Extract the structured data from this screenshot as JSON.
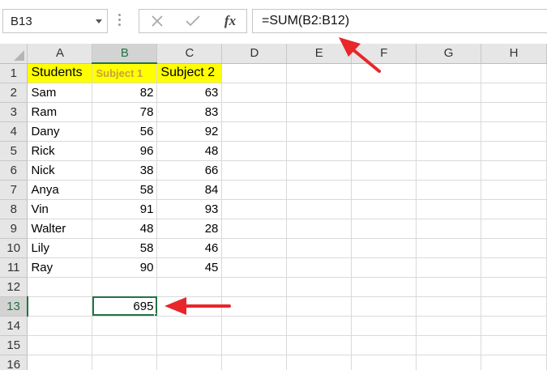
{
  "name_box": {
    "value": "B13"
  },
  "formula_bar": {
    "cancel_icon": "x-icon",
    "enter_icon": "check-icon",
    "function_label": "fx",
    "formula": "=SUM(B2:B12)"
  },
  "sheet": {
    "columns": [
      "A",
      "B",
      "C",
      "D",
      "E",
      "F",
      "G",
      "H"
    ],
    "selected_column": "B",
    "selected_row": "13",
    "header_row": {
      "num": "1",
      "a": "Students",
      "b": "Subject 1",
      "c": "Subject 2"
    },
    "rows": [
      {
        "num": "2",
        "a": "Sam",
        "b": "82",
        "c": "63"
      },
      {
        "num": "3",
        "a": "Ram",
        "b": "78",
        "c": "83"
      },
      {
        "num": "4",
        "a": "Dany",
        "b": "56",
        "c": "92"
      },
      {
        "num": "5",
        "a": "Rick",
        "b": "96",
        "c": "48"
      },
      {
        "num": "6",
        "a": "Nick",
        "b": "38",
        "c": "66"
      },
      {
        "num": "7",
        "a": "Anya",
        "b": "58",
        "c": "84"
      },
      {
        "num": "8",
        "a": "Vin",
        "b": "91",
        "c": "93"
      },
      {
        "num": "9",
        "a": "Walter",
        "b": "48",
        "c": "28"
      },
      {
        "num": "10",
        "a": "Lily",
        "b": "58",
        "c": "46"
      },
      {
        "num": "11",
        "a": "Ray",
        "b": "90",
        "c": "45"
      },
      {
        "num": "12",
        "a": "",
        "b": "",
        "c": ""
      },
      {
        "num": "13",
        "a": "",
        "b": "695",
        "c": ""
      },
      {
        "num": "14",
        "a": "",
        "b": "",
        "c": ""
      },
      {
        "num": "15",
        "a": "",
        "b": "",
        "c": ""
      },
      {
        "num": "16",
        "a": "",
        "b": "",
        "c": ""
      }
    ]
  },
  "colors": {
    "highlight_yellow": "#ffff00",
    "selection_green": "#217346",
    "annotation_red": "#e8262b"
  }
}
